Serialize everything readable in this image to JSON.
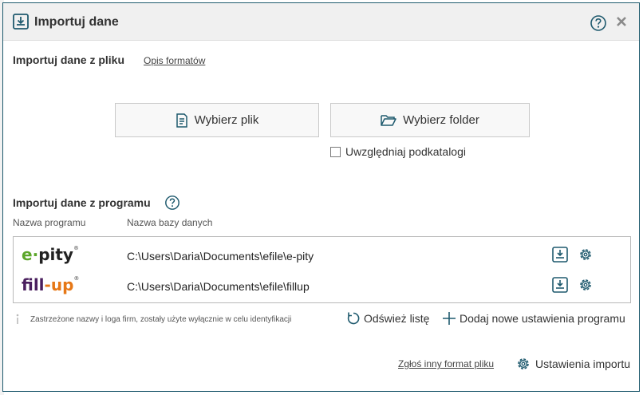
{
  "dialog": {
    "title": "Importuj dane",
    "icons": {
      "title": "import-icon",
      "help": "help-icon",
      "close": "close-icon"
    }
  },
  "file_section": {
    "title": "Importuj dane z pliku",
    "formats_link": "Opis formatów",
    "choose_file_button": "Wybierz plik",
    "choose_folder_button": "Wybierz folder",
    "subfolders_checkbox": {
      "label": "Uwzględniaj podkatalogi",
      "checked": false
    }
  },
  "program_section": {
    "title": "Importuj dane z programu",
    "column_program": "Nazwa programu",
    "column_database": "Nazwa bazy danych",
    "rows": [
      {
        "logo_a": "e",
        "logo_b": "pity",
        "path": "C:\\Users\\Daria\\Documents\\efile\\e-pity"
      },
      {
        "logo_a": "fill",
        "logo_b": "up",
        "path": "C:\\Users\\Daria\\Documents\\efile\\fillup"
      }
    ],
    "disclaimer": "Zastrzeżone nazwy i loga firm, zostały użyte wyłącznie w celu identyfikacji",
    "refresh_label": "Odśwież listę",
    "add_label": "Dodaj nowe ustawienia programu"
  },
  "footer": {
    "report_link": "Zgłoś inny format pliku",
    "settings_label": "Ustawienia importu"
  },
  "colors": {
    "accent": "#1f5a6e",
    "epity_green": "#5ca62a",
    "fillup_purple": "#4a1f5e",
    "fillup_orange": "#e67817"
  }
}
